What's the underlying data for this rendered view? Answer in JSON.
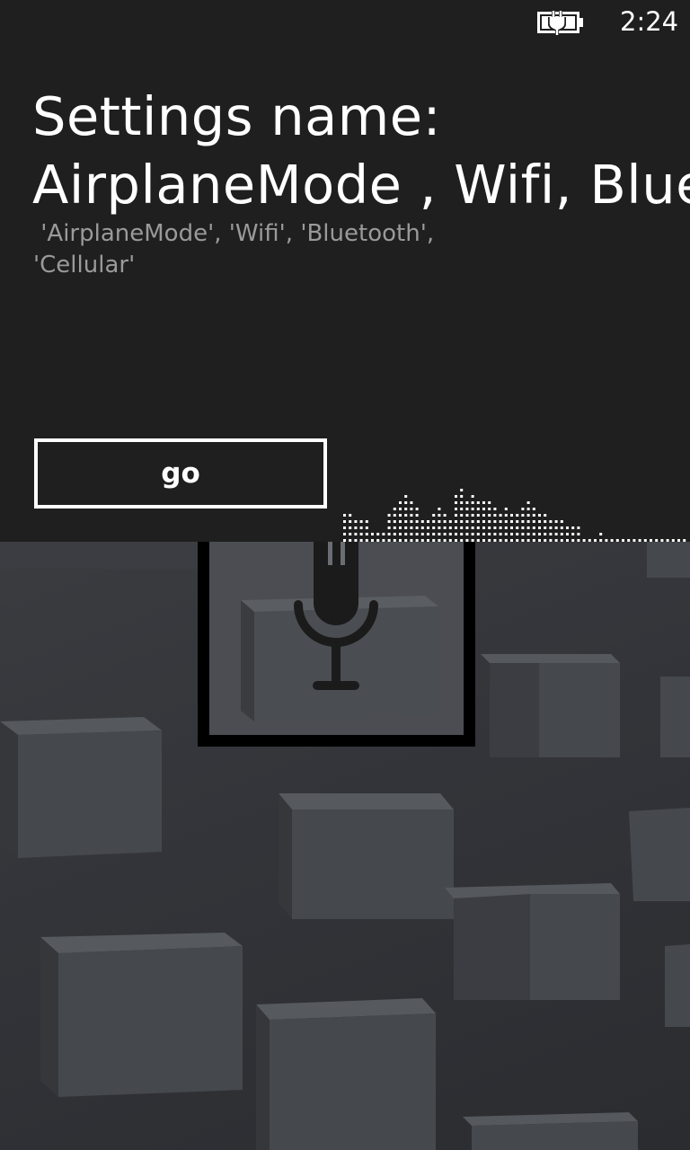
{
  "status_bar": {
    "time": "2:24",
    "battery_icon": "battery-charging-icon"
  },
  "main": {
    "title": "Settings name:\nAirplaneMode , Wifi, Blue",
    "subtitle": " 'AirplaneMode', 'Wifi', 'Bluetooth',\n'Cellular'",
    "go_label": "go"
  },
  "voice": {
    "mic_icon": "microphone-icon",
    "waveform_icon": "audio-level-meter"
  },
  "colors": {
    "background": "#1f1f1f",
    "text": "#ffffff",
    "subtitle": "#9a9a9a",
    "mic": "#1b1b1b"
  }
}
